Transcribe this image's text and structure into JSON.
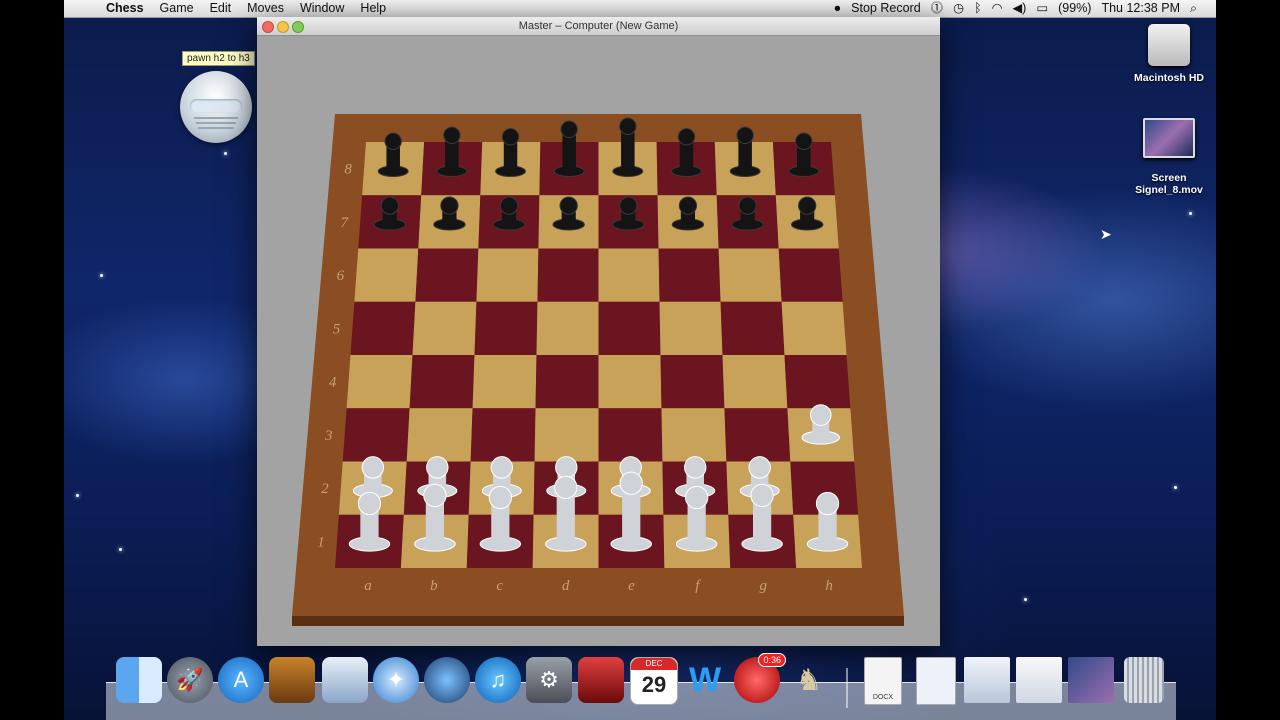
{
  "menubar": {
    "apple_icon": "apple-logo-icon",
    "app_name": "Chess",
    "items": [
      "Game",
      "Edit",
      "Moves",
      "Window",
      "Help"
    ],
    "status": {
      "recording": "Stop Record",
      "battery": "(99%)",
      "clock": "Thu 12:38 PM"
    }
  },
  "window": {
    "title": "Master  – Computer   (New Game)"
  },
  "board": {
    "files": [
      "a",
      "b",
      "c",
      "d",
      "e",
      "f",
      "g",
      "h"
    ],
    "ranks": [
      "8",
      "7",
      "6",
      "5",
      "4",
      "3",
      "2",
      "1"
    ],
    "light_square": "#c9a25a",
    "dark_square": "#6b1520",
    "frame": "#8a4e22"
  },
  "tooltip": {
    "text": "pawn h2 to h3"
  },
  "desktop": {
    "icons": [
      {
        "label": "Macintosh HD",
        "icon": "hard-drive-icon"
      },
      {
        "label": "Screen Signel_8.mov",
        "icon": "movie-file-icon"
      }
    ]
  },
  "dock": {
    "calendar_date": "29",
    "calendar_month": "DEC",
    "recorder_badge": "0:36",
    "doc_label": "DOCX"
  }
}
